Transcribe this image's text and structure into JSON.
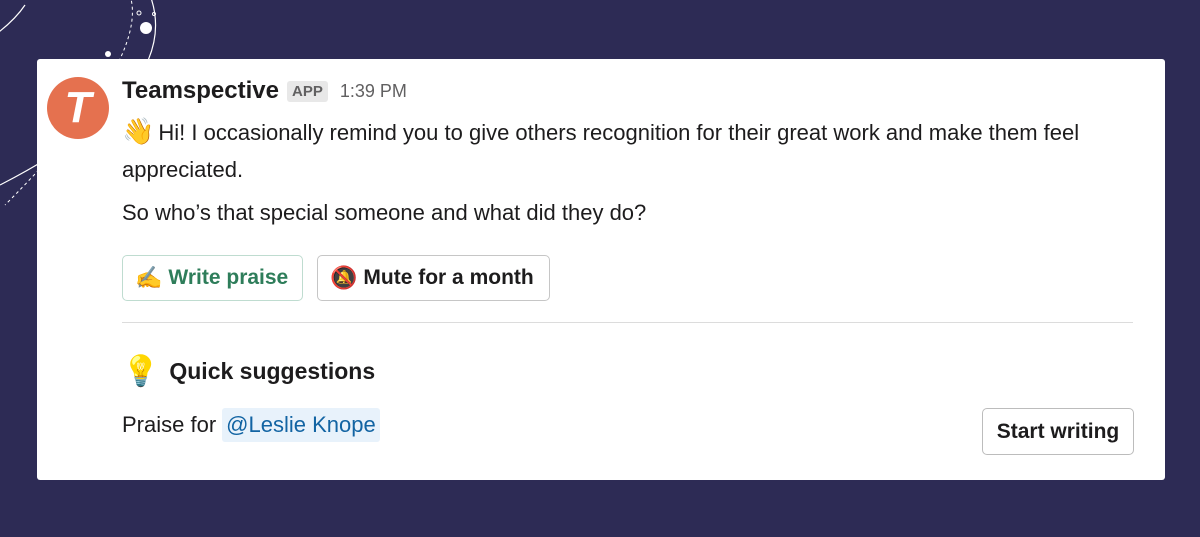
{
  "message": {
    "sender": "Teamspective",
    "badge": "APP",
    "time": "1:39 PM",
    "avatar_letter": "T",
    "line1": "Hi! I occasionally remind you to give others recognition for their great work and make them feel appreciated.",
    "line2": "So who’s that special someone and what did they do?"
  },
  "buttons": {
    "write_praise": "Write praise",
    "mute": "Mute for a month",
    "start_writing": "Start writing"
  },
  "quick": {
    "title": "Quick suggestions",
    "praise_for": "Praise for",
    "mention": "@Leslie Knope"
  },
  "icons": {
    "wave": "waving-hand-icon",
    "write": "writing-hand-icon",
    "mute": "muted-bell-icon",
    "bulb": "light-bulb-icon"
  },
  "colors": {
    "background": "#2d2b55",
    "avatar": "#e5714f",
    "praise_green": "#2e7d5a",
    "mention_blue": "#1264a3"
  }
}
